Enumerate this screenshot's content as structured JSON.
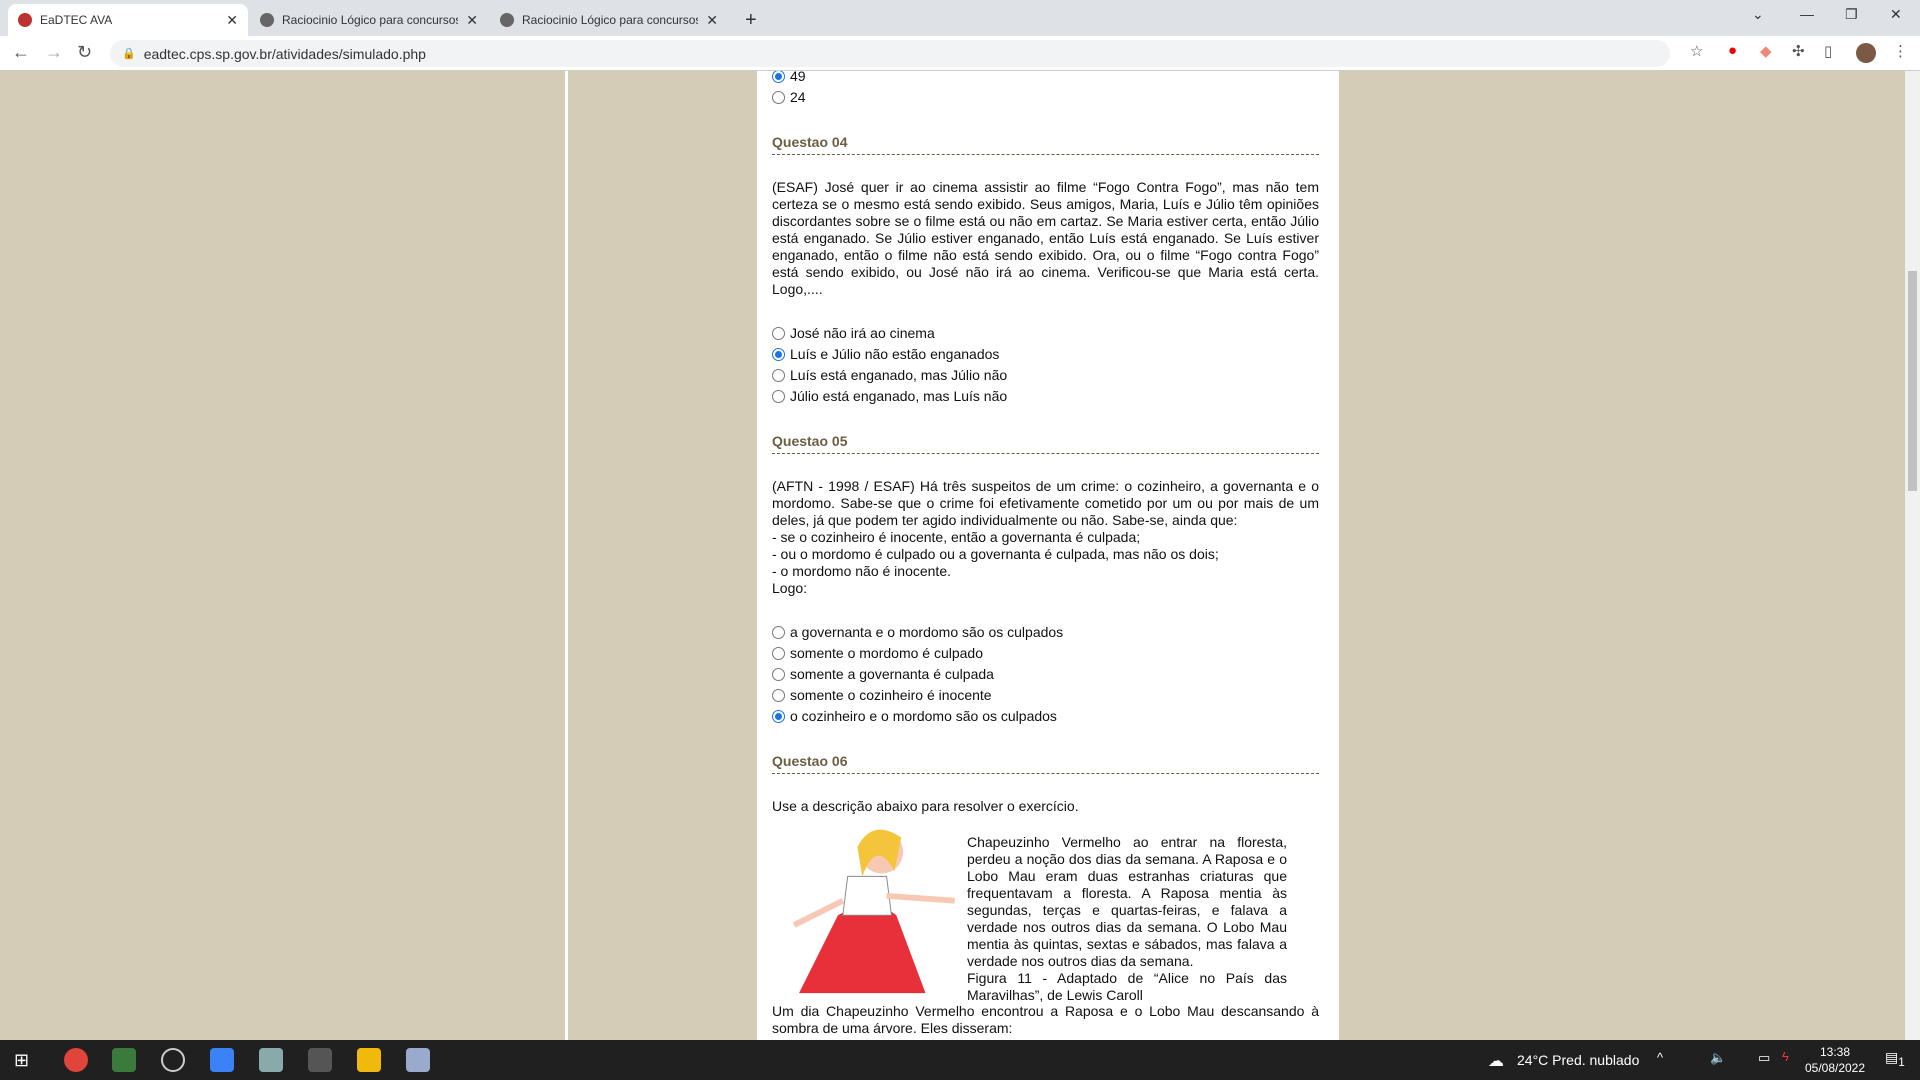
{
  "browser": {
    "tabs": [
      {
        "title": "EaDTEC AVA",
        "active": true
      },
      {
        "title": "Raciocinio Lógico para concursos"
      },
      {
        "title": "Raciocinio Lógico para concursos"
      }
    ],
    "url": "eadtec.cps.sp.gov.br/atividades/simulado.php"
  },
  "prev_options": [
    {
      "label": "49",
      "checked": true
    },
    {
      "label": "24",
      "checked": false
    }
  ],
  "q4": {
    "title": "Questao 04",
    "text": "(ESAF) José quer ir ao cinema assistir ao filme “Fogo Contra Fogo”, mas não tem certeza se o mesmo está sendo exibido. Seus amigos, Maria, Luís e Júlio têm opiniões discordantes sobre se o filme está ou não em cartaz. Se Maria estiver certa, então Júlio está enganado. Se Júlio estiver enganado, então Luís está enganado. Se Luís estiver enganado, então o filme não está sendo exibido. Ora, ou o filme “Fogo contra Fogo” está sendo exibido, ou José não irá ao cinema. Verificou-se que Maria está certa. Logo,....",
    "options": [
      {
        "label": "José não irá ao cinema"
      },
      {
        "label": "Luís e Júlio não estão enganados",
        "checked": true
      },
      {
        "label": "Luís está enganado, mas Júlio não"
      },
      {
        "label": "Júlio está enganado, mas Luís não"
      }
    ]
  },
  "q5": {
    "title": "Questao 05",
    "text": [
      "(AFTN - 1998 / ESAF) Há três suspeitos de um crime: o cozinheiro, a governanta e o mordomo. Sabe-se que o crime foi efetivamente cometido por um ou por mais de um deles, já que podem ter agido individualmente ou não. Sabe-se, ainda que:",
      "- se o cozinheiro é inocente, então a governanta é culpada;",
      "- ou o mordomo é culpado ou a governanta é culpada, mas não os dois;",
      "- o mordomo não é inocente.",
      "Logo:"
    ],
    "options": [
      {
        "label": "a governanta e o mordomo são os culpados"
      },
      {
        "label": "somente o mordomo é culpado"
      },
      {
        "label": "somente a governanta é culpada"
      },
      {
        "label": "somente o cozinheiro é inocente"
      },
      {
        "label": "o cozinheiro e o mordomo são os culpados",
        "checked": true
      }
    ]
  },
  "q6": {
    "title": "Questao 06",
    "intro": "Use a descrição abaixo para resolver o exercício.",
    "figure_text": "Chapeuzinho Vermelho ao entrar na floresta, perdeu a noção dos dias da semana. A Raposa e o Lobo Mau eram duas estranhas criaturas que frequentavam a floresta. A Raposa mentia às segundas, terças e quartas-feiras, e falava a verdade nos outros dias da semana. O Lobo Mau mentia às quintas, sextas e sábados, mas falava a verdade nos outros dias da semana.",
    "caption": "Figura 11 - Adaptado de “Alice no País das Maravilhas”, de Lewis Caroll",
    "after": "Um dia Chapeuzinho Vermelho encontrou a Raposa e o Lobo Mau descansando à sombra de uma árvore. Eles disseram:"
  },
  "taskbar": {
    "weather": "24°C  Pred. nublado",
    "time": "13:38",
    "date": "05/08/2022",
    "notifications": "1"
  }
}
